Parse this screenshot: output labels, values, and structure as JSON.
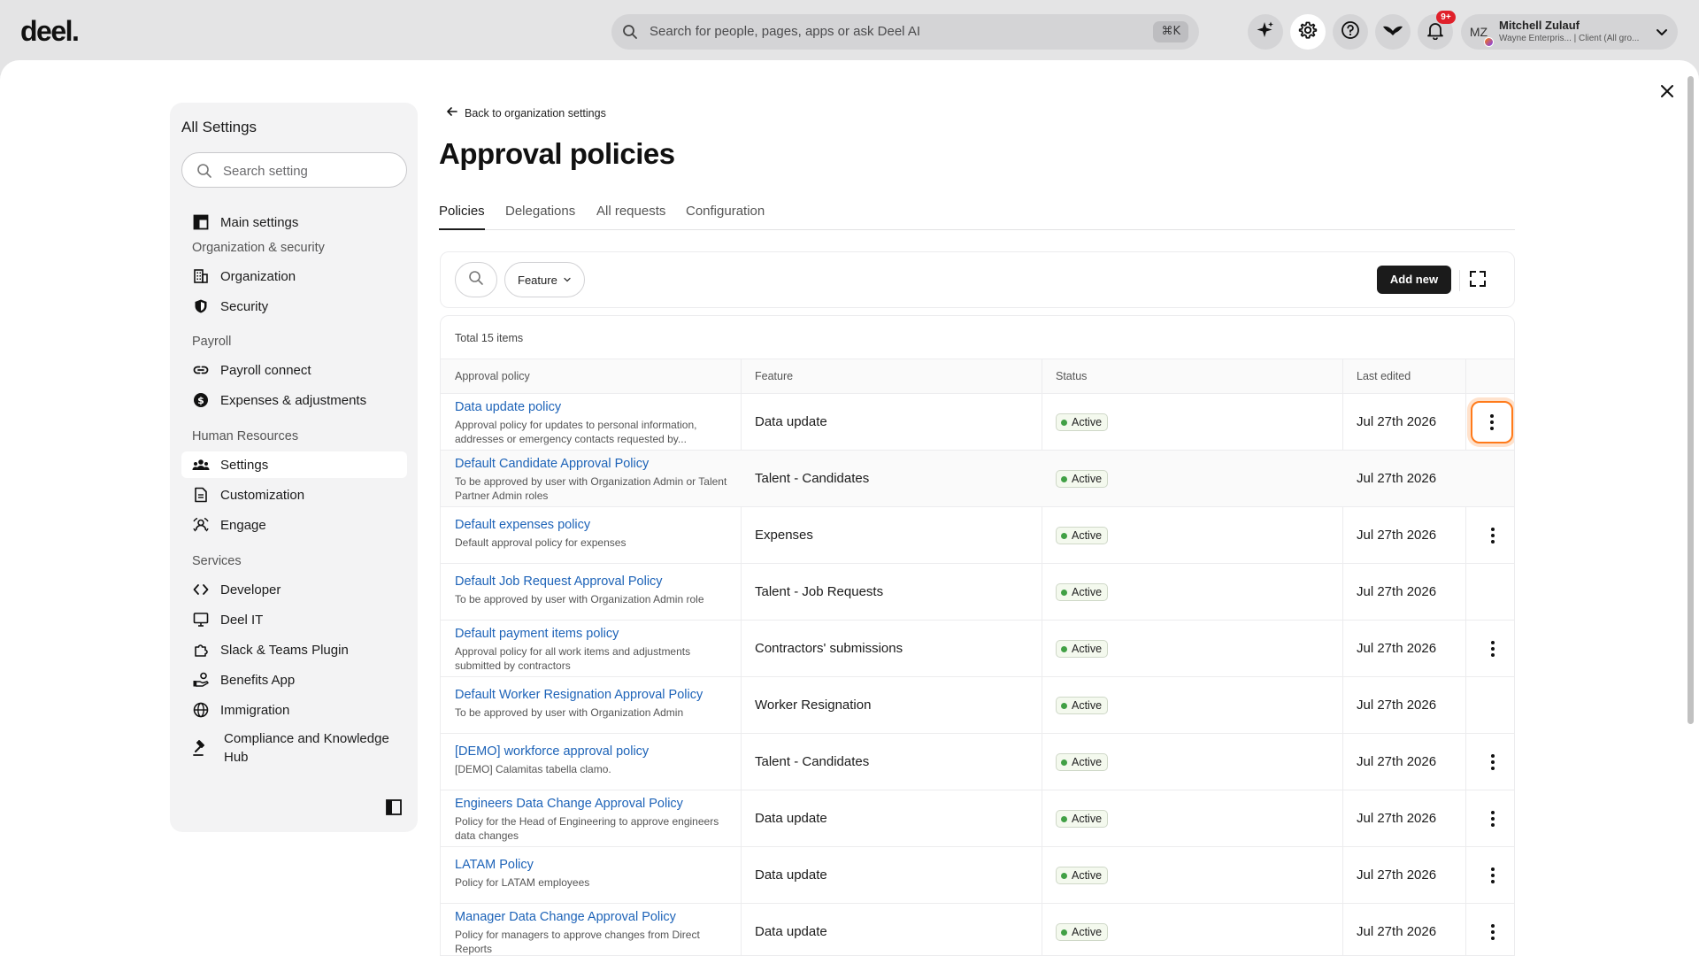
{
  "topbar": {
    "logo": "deel.",
    "search_placeholder": "Search for people, pages, apps or ask Deel AI",
    "search_shortcut": "⌘K",
    "notifications_badge": "9+",
    "user": {
      "initials": "MZ",
      "name": "Mitchell Zulauf",
      "subtitle": "Wayne Enterpris... | Client (All gro..."
    }
  },
  "sidebar": {
    "title": "All Settings",
    "search_placeholder": "Search setting",
    "main_settings": "Main settings",
    "sections": {
      "org_security": "Organization & security",
      "payroll": "Payroll",
      "hr": "Human Resources",
      "services": "Services"
    },
    "items": {
      "organization": "Organization",
      "security": "Security",
      "payroll_connect": "Payroll connect",
      "expenses": "Expenses & adjustments",
      "settings": "Settings",
      "customization": "Customization",
      "engage": "Engage",
      "developer": "Developer",
      "deel_it": "Deel IT",
      "slack": "Slack & Teams Plugin",
      "benefits": "Benefits App",
      "immigration": "Immigration",
      "compliance_1": "Compliance and Knowledge",
      "compliance_2": "Hub"
    }
  },
  "content": {
    "back_label": "Back to organization settings",
    "title": "Approval policies",
    "tabs": [
      "Policies",
      "Delegations",
      "All requests",
      "Configuration"
    ],
    "toolbar": {
      "feature_filter": "Feature",
      "add_new": "Add new"
    },
    "total": "Total 15 items",
    "columns": [
      "Approval policy",
      "Feature",
      "Status",
      "Last edited"
    ],
    "rows": [
      {
        "name": "Data update policy",
        "desc": "Approval policy for updates to personal information, addresses or emergency contacts requested by...",
        "feature": "Data update",
        "status": "Active",
        "date": "Jul 27th 2026",
        "menu": true
      },
      {
        "name": "Default Candidate Approval Policy",
        "desc": "To be approved by user with Organization Admin or Talent Partner Admin roles",
        "feature": "Talent - Candidates",
        "status": "Active",
        "date": "Jul 27th 2026",
        "menu": false
      },
      {
        "name": "Default expenses policy",
        "desc": "Default approval policy for expenses",
        "feature": "Expenses",
        "status": "Active",
        "date": "Jul 27th 2026",
        "menu": true
      },
      {
        "name": "Default Job Request Approval Policy",
        "desc": "To be approved by user with Organization Admin role",
        "feature": "Talent - Job Requests",
        "status": "Active",
        "date": "Jul 27th 2026",
        "menu": false
      },
      {
        "name": "Default payment items policy",
        "desc": "Approval policy for all work items and adjustments submitted by contractors",
        "feature": "Contractors' submissions",
        "status": "Active",
        "date": "Jul 27th 2026",
        "menu": true
      },
      {
        "name": "Default Worker Resignation Approval Policy",
        "desc": "To be approved by user with Organization Admin",
        "feature": "Worker Resignation",
        "status": "Active",
        "date": "Jul 27th 2026",
        "menu": false
      },
      {
        "name": "[DEMO] workforce approval policy",
        "desc": "[DEMO] Calamitas tabella clamo.",
        "feature": "Talent - Candidates",
        "status": "Active",
        "date": "Jul 27th 2026",
        "menu": true
      },
      {
        "name": "Engineers Data Change Approval Policy",
        "desc": "Policy for the Head of Engineering to approve engineers data changes",
        "feature": "Data update",
        "status": "Active",
        "date": "Jul 27th 2026",
        "menu": true
      },
      {
        "name": "LATAM Policy",
        "desc": "Policy for LATAM employees",
        "feature": "Data update",
        "status": "Active",
        "date": "Jul 27th 2026",
        "menu": true
      },
      {
        "name": "Manager Data Change Approval Policy",
        "desc": "Policy for managers to approve changes from Direct Reports",
        "feature": "Data update",
        "status": "Active",
        "date": "Jul 27th 2026",
        "menu": true
      }
    ]
  },
  "colors": {
    "link": "#1d63b8",
    "active_dot": "#41a045",
    "focus_ring": "#ff7a1a",
    "notification": "#e0202a"
  }
}
